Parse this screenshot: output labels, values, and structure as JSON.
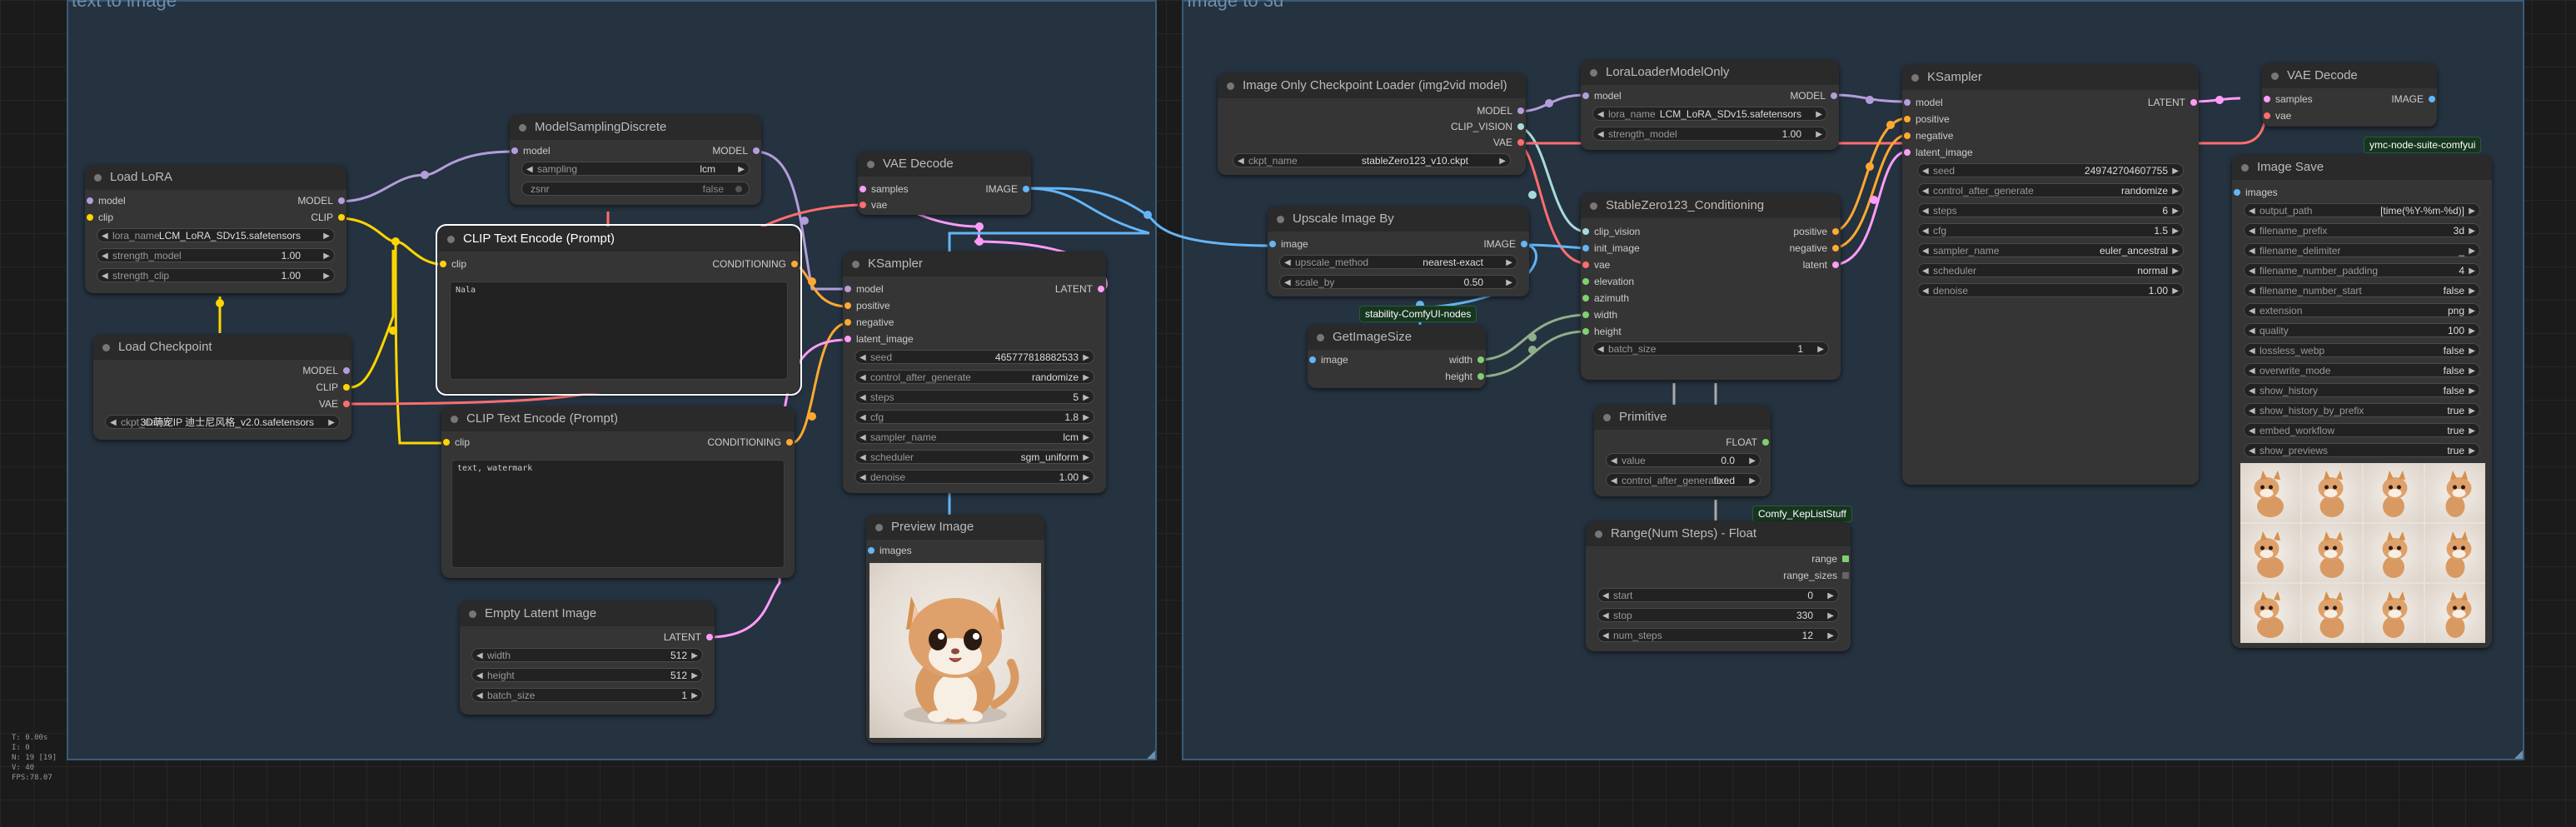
{
  "groups": {
    "left": {
      "title": "text to image"
    },
    "right": {
      "title": "Image to 3d"
    }
  },
  "colors": {
    "model": "#b39ddb",
    "clip": "#ffd500",
    "vae": "#ff6e6e",
    "conditioning": "#ffa931",
    "latent": "#ff9cf9",
    "image": "#64b5f6",
    "clip_vision": "#a8dadc",
    "int": "#7fd170",
    "float": "#7fd170"
  },
  "nodes": {
    "load_lora": {
      "title": "Load LoRA",
      "in_model": "model",
      "in_clip": "clip",
      "out_model": "MODEL",
      "out_clip": "CLIP",
      "lora_name_label": "lora_name",
      "lora_name_value": "LCM_LoRA_SDv15.safetensors",
      "strength_model_label": "strength_model",
      "strength_model_value": "1.00",
      "strength_clip_label": "strength_clip",
      "strength_clip_value": "1.00"
    },
    "load_checkpoint": {
      "title": "Load Checkpoint",
      "out_model": "MODEL",
      "out_clip": "CLIP",
      "out_vae": "VAE",
      "ckpt_label": "ckpt_name",
      "ckpt_value": "3D萌宠IP 迪士尼风格_v2.0.safetensors"
    },
    "model_sampling": {
      "title": "ModelSamplingDiscrete",
      "in_model": "model",
      "out_model": "MODEL",
      "sampling_label": "sampling",
      "sampling_value": "lcm",
      "zsnr_label": "zsnr",
      "zsnr_value": "false"
    },
    "clip_pos": {
      "title": "CLIP Text Encode (Prompt)",
      "in_clip": "clip",
      "out": "CONDITIONING",
      "text": "Nala"
    },
    "clip_neg": {
      "title": "CLIP Text Encode (Prompt)",
      "in_clip": "clip",
      "out": "CONDITIONING",
      "text": "text, watermark"
    },
    "empty_latent": {
      "title": "Empty Latent Image",
      "out": "LATENT",
      "width_label": "width",
      "width_value": "512",
      "height_label": "height",
      "height_value": "512",
      "batch_label": "batch_size",
      "batch_value": "1"
    },
    "vae_decode_1": {
      "title": "VAE Decode",
      "in_samples": "samples",
      "in_vae": "vae",
      "out": "IMAGE"
    },
    "ksampler_1": {
      "title": "KSampler",
      "in_model": "model",
      "in_positive": "positive",
      "in_negative": "negative",
      "in_latent": "latent_image",
      "out": "LATENT",
      "seed_label": "seed",
      "seed_value": "465777818882533",
      "cag_label": "control_after_generate",
      "cag_value": "randomize",
      "steps_label": "steps",
      "steps_value": "5",
      "cfg_label": "cfg",
      "cfg_value": "1.8",
      "sampler_label": "sampler_name",
      "sampler_value": "lcm",
      "scheduler_label": "scheduler",
      "scheduler_value": "sgm_uniform",
      "denoise_label": "denoise",
      "denoise_value": "1.00"
    },
    "preview": {
      "title": "Preview Image",
      "in_images": "images"
    },
    "img_ckpt": {
      "title": "Image Only Checkpoint Loader (img2vid model)",
      "out_model": "MODEL",
      "out_clip_vision": "CLIP_VISION",
      "out_vae": "VAE",
      "ckpt_label": "ckpt_name",
      "ckpt_value": "stableZero123_v10.ckpt"
    },
    "upscale": {
      "title": "Upscale Image By",
      "in_image": "image",
      "out": "IMAGE",
      "method_label": "upscale_method",
      "method_value": "nearest-exact",
      "scale_label": "scale_by",
      "scale_value": "0.50",
      "badge": "stability-ComfyUI-nodes"
    },
    "get_size": {
      "title": "GetImageSize",
      "in_image": "image",
      "out_width": "width",
      "out_height": "height"
    },
    "lora2": {
      "title": "LoraLoaderModelOnly",
      "in_model": "model",
      "out_model": "MODEL",
      "lora_label": "lora_name",
      "lora_value": "LCM_LoRA_SDv15.safetensors",
      "strength_label": "strength_model",
      "strength_value": "1.00"
    },
    "sz123": {
      "title": "StableZero123_Conditioning",
      "in_clip_vision": "clip_vision",
      "in_init_image": "init_image",
      "in_vae": "vae",
      "in_elevation": "elevation",
      "in_azimuth": "azimuth",
      "in_width": "width",
      "in_height": "height",
      "out_positive": "positive",
      "out_negative": "negative",
      "out_latent": "latent",
      "batch_label": "batch_size",
      "batch_value": "1"
    },
    "primitive": {
      "title": "Primitive",
      "out": "FLOAT",
      "value_label": "value",
      "value_value": "0.0",
      "cag_label": "control_after_generate",
      "cag_value": "fixed",
      "badge": "Comfy_KepListStuff"
    },
    "range": {
      "title": "Range(Num Steps) - Float",
      "out_range": "range",
      "out_sizes": "range_sizes",
      "start_label": "start",
      "start_value": "0",
      "stop_label": "stop",
      "stop_value": "330",
      "num_label": "num_steps",
      "num_value": "12"
    },
    "ksampler_2": {
      "title": "KSampler",
      "in_model": "model",
      "in_positive": "positive",
      "in_negative": "negative",
      "in_latent": "latent_image",
      "out": "LATENT",
      "seed_label": "seed",
      "seed_value": "249742704607755",
      "cag_label": "control_after_generate",
      "cag_value": "randomize",
      "steps_label": "steps",
      "steps_value": "6",
      "cfg_label": "cfg",
      "cfg_value": "1.5",
      "sampler_label": "sampler_name",
      "sampler_value": "euler_ancestral",
      "scheduler_label": "scheduler",
      "scheduler_value": "normal",
      "denoise_label": "denoise",
      "denoise_value": "1.00"
    },
    "vae_decode_2": {
      "title": "VAE Decode",
      "in_samples": "samples",
      "in_vae": "vae",
      "out": "IMAGE",
      "badge": "ymc-node-suite-comfyui"
    },
    "image_save": {
      "title": "Image Save",
      "in_images": "images",
      "widgets": [
        {
          "label": "output_path",
          "value": "[time(%Y-%m-%d)]"
        },
        {
          "label": "filename_prefix",
          "value": "3d"
        },
        {
          "label": "filename_delimiter",
          "value": "_"
        },
        {
          "label": "filename_number_padding",
          "value": "4"
        },
        {
          "label": "filename_number_start",
          "value": "false"
        },
        {
          "label": "extension",
          "value": "png"
        },
        {
          "label": "quality",
          "value": "100"
        },
        {
          "label": "lossless_webp",
          "value": "false"
        },
        {
          "label": "overwrite_mode",
          "value": "false"
        },
        {
          "label": "show_history",
          "value": "false"
        },
        {
          "label": "show_history_by_prefix",
          "value": "true"
        },
        {
          "label": "embed_workflow",
          "value": "true"
        },
        {
          "label": "show_previews",
          "value": "true"
        }
      ]
    }
  },
  "stats": {
    "line1": "T: 0.00s",
    "line2": "I: 0",
    "line3": "N: 19 [19]",
    "line4": "V: 40",
    "line5": "FPS:78.07"
  }
}
